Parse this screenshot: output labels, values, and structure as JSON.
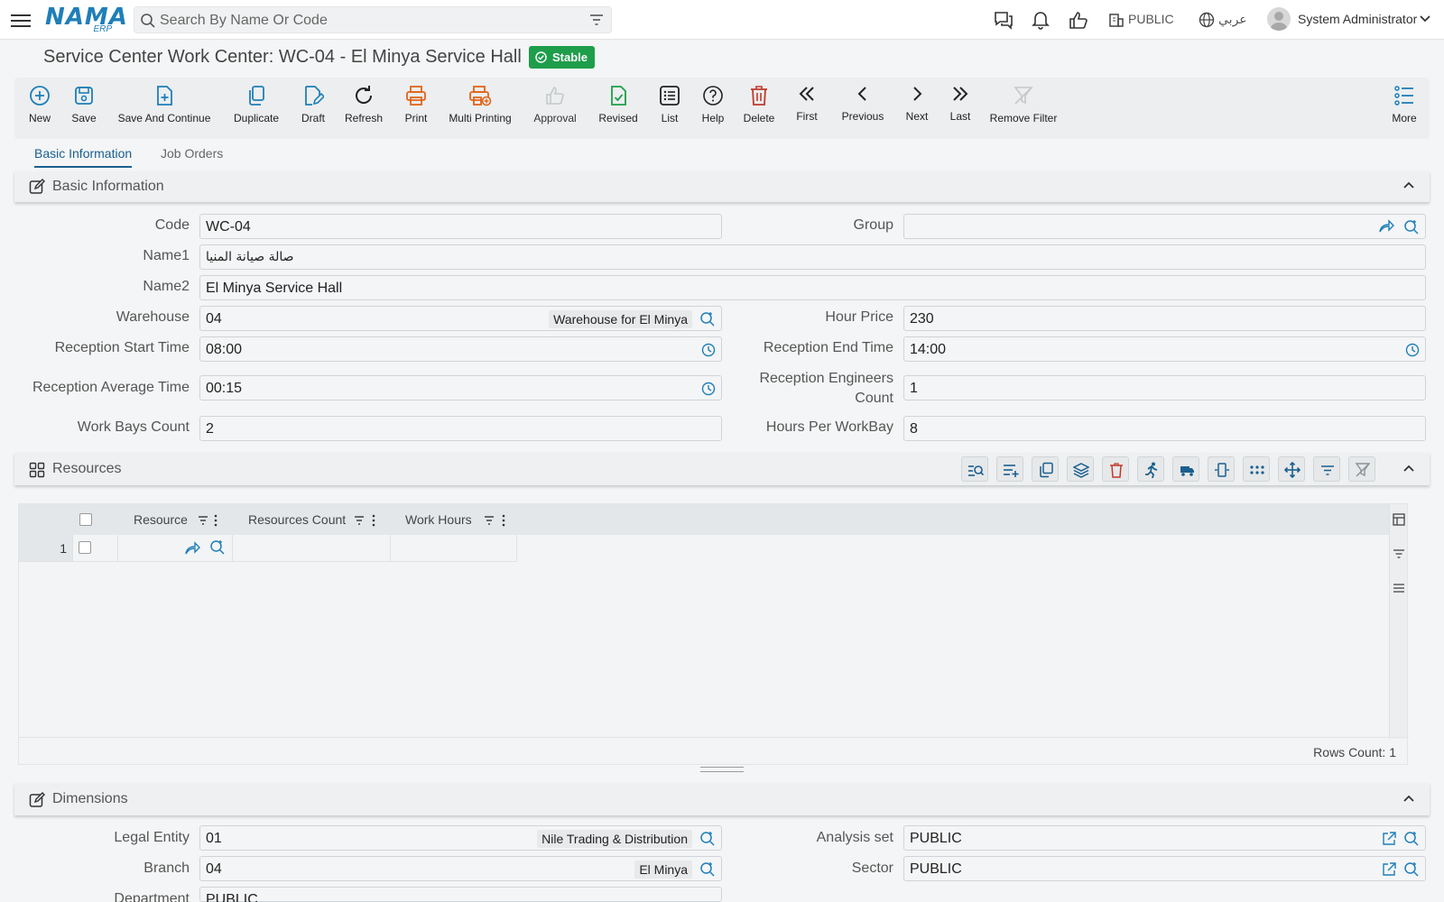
{
  "topbar": {
    "logo_text": "NAMA",
    "logo_sub": "ERP",
    "search_placeholder": "Search By Name Or Code",
    "company": "PUBLIC",
    "language": "عربي",
    "user": "System Administrator"
  },
  "header": {
    "title": "Service Center Work Center: WC-04 - El Minya Service Hall",
    "status": "Stable"
  },
  "toolbar": {
    "new": "New",
    "save": "Save",
    "save_continue": "Save And Continue",
    "duplicate": "Duplicate",
    "draft": "Draft",
    "refresh": "Refresh",
    "print": "Print",
    "multi_printing": "Multi Printing",
    "approval": "Approval",
    "revised": "Revised",
    "list": "List",
    "help": "Help",
    "delete": "Delete",
    "first": "First",
    "previous": "Previous",
    "next": "Next",
    "last": "Last",
    "remove_filter": "Remove Filter",
    "more": "More"
  },
  "tabs": {
    "basic": "Basic Information",
    "job_orders": "Job Orders"
  },
  "basic": {
    "section_title": "Basic Information",
    "code_label": "Code",
    "code": "WC-04",
    "group_label": "Group",
    "group": "",
    "name1_label": "Name1",
    "name1": "صالة صيانة المنيا",
    "name2_label": "Name2",
    "name2": "El Minya Service Hall",
    "warehouse_label": "Warehouse",
    "warehouse": "04",
    "warehouse_desc": "Warehouse for El Minya",
    "hour_price_label": "Hour Price",
    "hour_price": "230",
    "rec_start_label": "Reception Start Time",
    "rec_start": "08:00",
    "rec_end_label": "Reception End Time",
    "rec_end": "14:00",
    "rec_avg_label": "Reception Average Time",
    "rec_avg": "00:15",
    "rec_eng_label_1": "Reception Engineers",
    "rec_eng_label_2": "Count",
    "rec_eng": "1",
    "bays_label": "Work Bays Count",
    "bays": "2",
    "hours_bay_label": "Hours Per WorkBay",
    "hours_bay": "8"
  },
  "resources": {
    "section_title": "Resources",
    "columns": [
      "Resource",
      "Resources Count",
      "Work Hours"
    ],
    "rows": [
      {
        "num": "1",
        "resource": "",
        "count": "",
        "hours": ""
      }
    ],
    "rows_count": "Rows Count: 1"
  },
  "dimensions": {
    "section_title": "Dimensions",
    "legal_label": "Legal Entity",
    "legal": "01",
    "legal_desc": "Nile Trading & Distribution",
    "analysis_label": "Analysis set",
    "analysis": "PUBLIC",
    "branch_label": "Branch",
    "branch": "04",
    "branch_desc": "El Minya",
    "sector_label": "Sector",
    "sector": "PUBLIC",
    "department_label": "Department",
    "department": "PUBLIC"
  },
  "colors": {
    "accent": "#1a5f8f",
    "icon_blue": "#1f7fb8",
    "stable_green": "#1e9e4a",
    "print_orange": "#e0641a",
    "delete_red": "#c0392b"
  }
}
